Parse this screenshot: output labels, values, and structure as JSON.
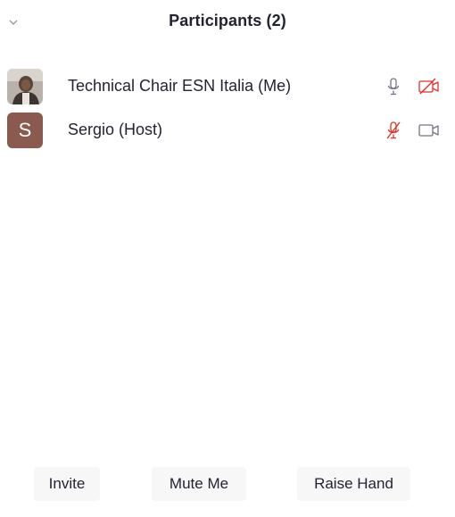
{
  "header": {
    "title": "Participants (2)",
    "collapse_icon": "chevron-down-icon"
  },
  "participants": [
    {
      "name": "Technical Chair ESN Italia (Me)",
      "avatar_type": "photo",
      "mic_icon": "microphone-icon",
      "mic_muted": false,
      "camera_icon": "video-off-icon",
      "camera_on": false
    },
    {
      "name": "Sergio (Host)",
      "avatar_type": "letter",
      "avatar_letter": "S",
      "avatar_color": "#8a5a4e",
      "mic_icon": "microphone-muted-icon",
      "mic_muted": true,
      "camera_icon": "video-camera-icon",
      "camera_on": true
    }
  ],
  "footer": {
    "invite_label": "Invite",
    "mute_me_label": "Mute Me",
    "raise_hand_label": "Raise Hand"
  },
  "colors": {
    "muted_red": "#e0322b",
    "icon_gray": "#747487",
    "text": "#232333",
    "button_bg": "#f7f7f8"
  }
}
